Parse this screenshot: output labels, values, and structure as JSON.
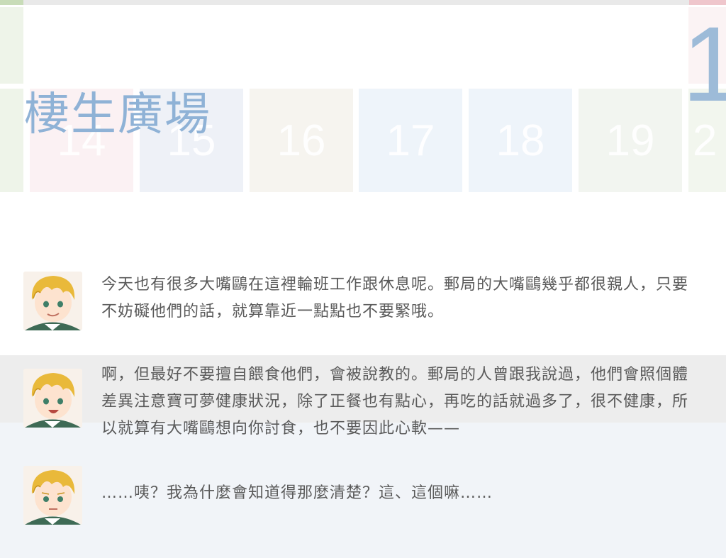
{
  "header": {
    "title": "棲生廣場",
    "month_number": "1"
  },
  "calendar": {
    "days": [
      "14",
      "15",
      "16",
      "17",
      "18",
      "19",
      "2"
    ],
    "day_colors": [
      "#fbf1f3",
      "#eef1f7",
      "#f6f4ef",
      "#eef4fa",
      "#eef4fa",
      "#f2f5f0",
      "#f2f6ee"
    ]
  },
  "messages": [
    {
      "speaker_icon": "blonde-boy-avatar-smiling",
      "text": "今天也有很多大嘴鷗在這裡輪班工作跟休息呢。郵局的大嘴鷗幾乎都很親人，只要不妨礙他們的話，就算靠近一點點也不要緊哦。"
    },
    {
      "speaker_icon": "blonde-boy-avatar-open-mouth",
      "text": "啊，但最好不要擅自餵食他們，會被說教的。郵局的人曾跟我說過，他們會照個體差異注意寶可夢健康狀況，除了正餐也有點心，再吃的話就過多了，很不健康，所以就算有大嘴鷗想向你討食，也不要因此心軟——"
    },
    {
      "speaker_icon": "blonde-boy-avatar-worried",
      "text": "……咦？我為什麼會知道得那麼清楚？這、這個嘛……"
    }
  ],
  "colors": {
    "title": "#8fb2d6",
    "text": "#5a5a5a",
    "band_grey": "#ededed",
    "band_blue": "#f1f4f8"
  }
}
